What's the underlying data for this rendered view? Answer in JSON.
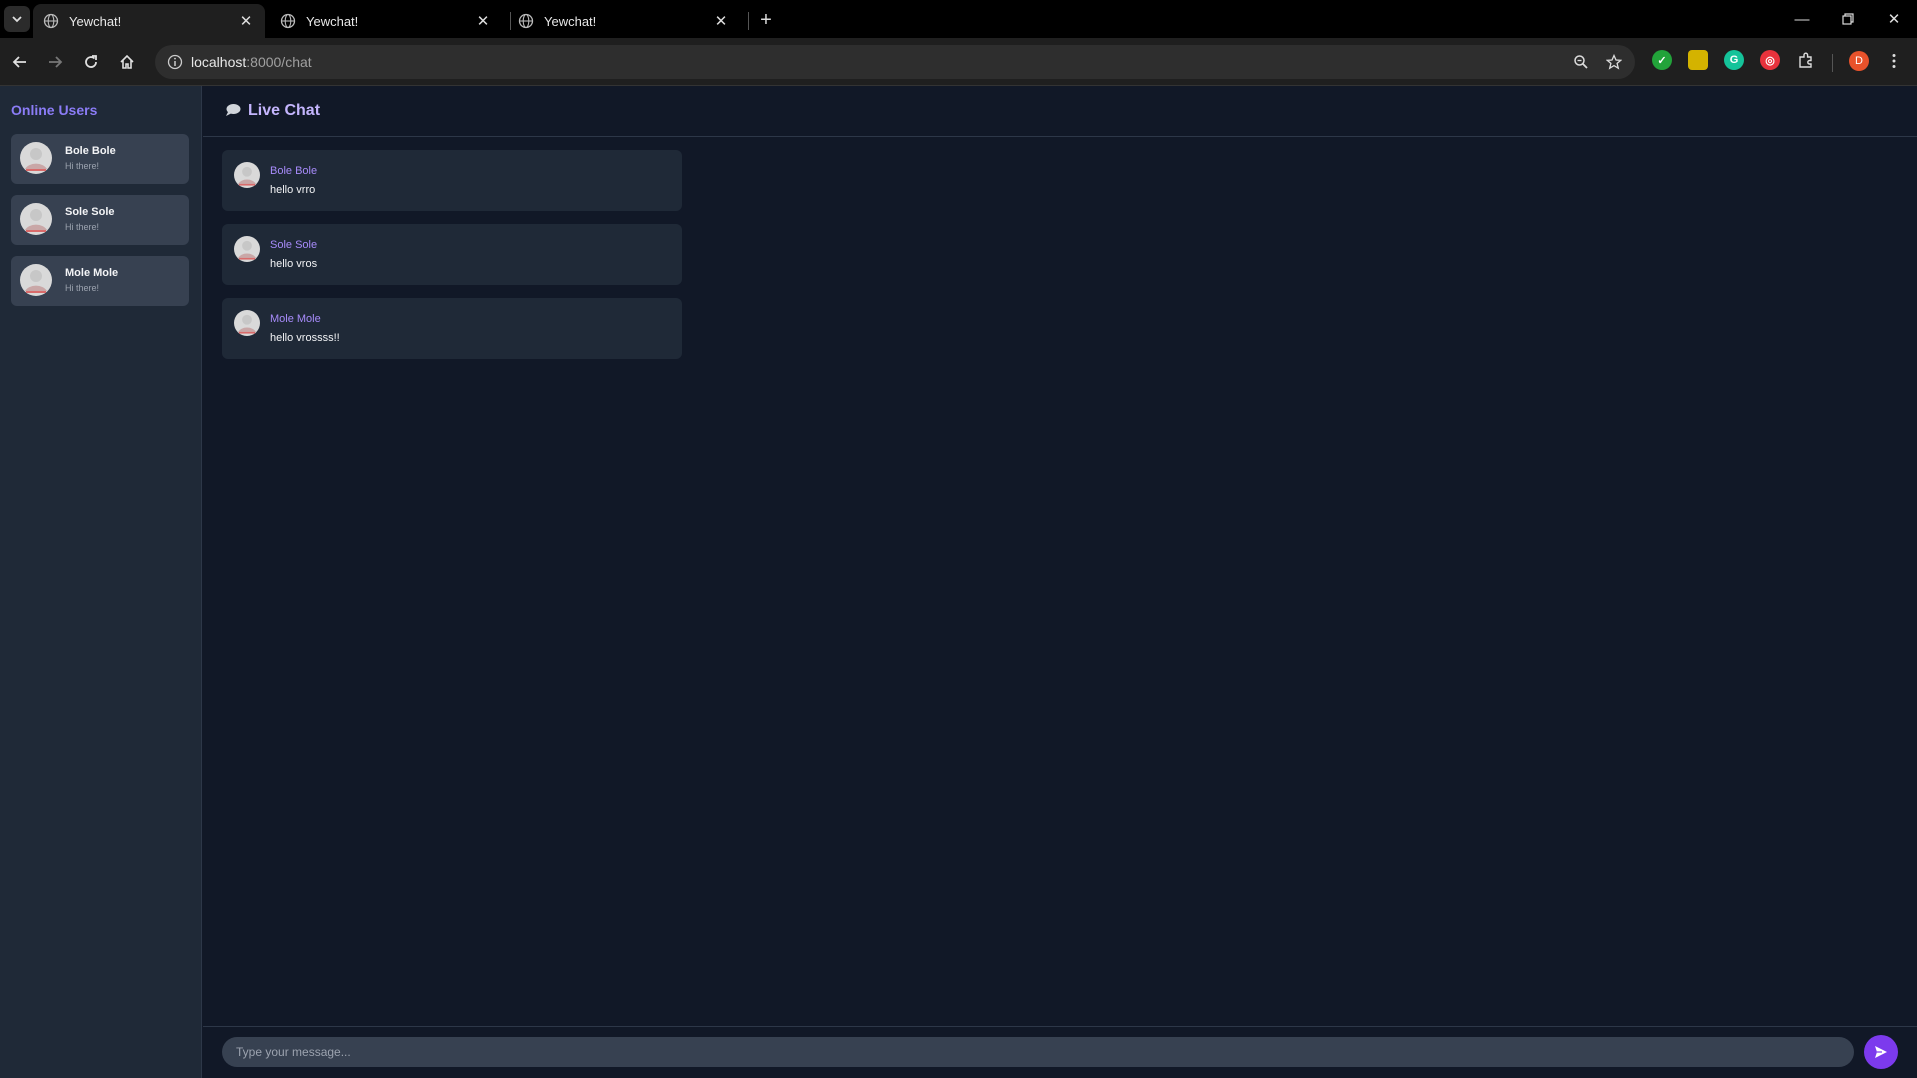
{
  "browser": {
    "tabs": [
      {
        "title": "Yewchat!",
        "active": true
      },
      {
        "title": "Yewchat!",
        "active": false
      },
      {
        "title": "Yewchat!",
        "active": false
      }
    ],
    "url_host": "localhost",
    "url_path": ":8000/chat",
    "profile_initial": "D",
    "icons": {
      "tab_list": "chevron-down-icon",
      "tab_favicon": "globe-icon",
      "tab_close": "close-icon",
      "new_tab": "plus-icon",
      "back": "arrow-left-icon",
      "forward": "arrow-right-icon",
      "reload": "reload-icon",
      "home": "home-icon",
      "site_info": "info-icon",
      "zoom": "zoom-icon",
      "bookmark": "star-icon",
      "extensions": "puzzle-icon",
      "menu": "kebab-menu-icon"
    },
    "extension_colors": [
      "#22a33a",
      "#d4b300",
      "#15c39a",
      "#e8323c"
    ]
  },
  "sidebar": {
    "title": "Online Users",
    "users": [
      {
        "name": "Bole Bole",
        "status": "Hi there!"
      },
      {
        "name": "Sole Sole",
        "status": "Hi there!"
      },
      {
        "name": "Mole Mole",
        "status": "Hi there!"
      }
    ]
  },
  "chat": {
    "title": "Live Chat",
    "icon": "speech-bubble-icon",
    "messages": [
      {
        "sender": "Bole Bole",
        "text": "hello vrro"
      },
      {
        "sender": "Sole Sole",
        "text": "hello vros"
      },
      {
        "sender": "Mole Mole",
        "text": "hello vrossss!!"
      }
    ]
  },
  "composer": {
    "placeholder": "Type your message...",
    "value": "",
    "send_icon": "send-icon"
  },
  "colors": {
    "accent": "#7c3aed",
    "name_color": "#a78bfa",
    "background": "#111827",
    "panel": "#1f2937",
    "card": "#374151"
  }
}
